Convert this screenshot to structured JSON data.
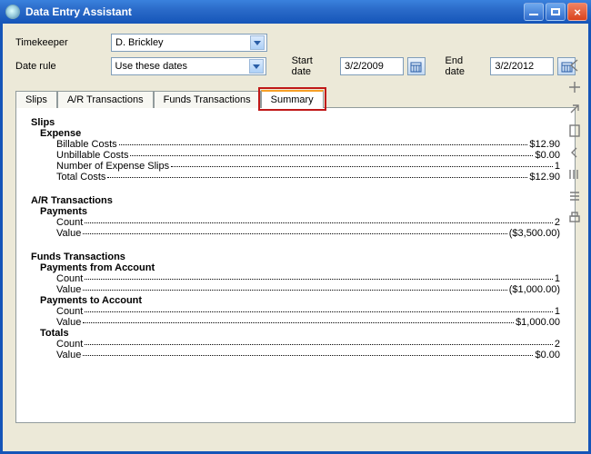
{
  "window": {
    "title": "Data Entry Assistant"
  },
  "form": {
    "timekeeper_label": "Timekeeper",
    "timekeeper_value": "D. Brickley",
    "daterule_label": "Date rule",
    "daterule_value": "Use these dates",
    "startdate_label": "Start date",
    "startdate_value": "3/2/2009",
    "enddate_label": "End date",
    "enddate_value": "3/2/2012"
  },
  "tabs": {
    "slips": "Slips",
    "ar": "A/R Transactions",
    "funds": "Funds Transactions",
    "summary": "Summary",
    "active": "summary"
  },
  "summary": {
    "slips": {
      "header": "Slips",
      "expense": {
        "header": "Expense",
        "lines": {
          "billable": {
            "label": "Billable Costs",
            "value": "$12.90"
          },
          "unbillable": {
            "label": "Unbillable Costs",
            "value": "$0.00"
          },
          "count": {
            "label": "Number of Expense Slips",
            "value": "1"
          },
          "total": {
            "label": "Total Costs",
            "value": "$12.90"
          }
        }
      }
    },
    "ar": {
      "header": "A/R Transactions",
      "payments": {
        "header": "Payments",
        "lines": {
          "count": {
            "label": "Count",
            "value": "2"
          },
          "value": {
            "label": "Value",
            "value": "($3,500.00)"
          }
        }
      }
    },
    "funds": {
      "header": "Funds Transactions",
      "from": {
        "header": "Payments from Account",
        "lines": {
          "count": {
            "label": "Count",
            "value": "1"
          },
          "value": {
            "label": "Value",
            "value": "($1,000.00)"
          }
        }
      },
      "to": {
        "header": "Payments to Account",
        "lines": {
          "count": {
            "label": "Count",
            "value": "1"
          },
          "value": {
            "label": "Value",
            "value": "$1,000.00"
          }
        }
      },
      "totals": {
        "header": "Totals",
        "lines": {
          "count": {
            "label": "Count",
            "value": "2"
          },
          "value": {
            "label": "Value",
            "value": "$0.00"
          }
        }
      }
    }
  }
}
